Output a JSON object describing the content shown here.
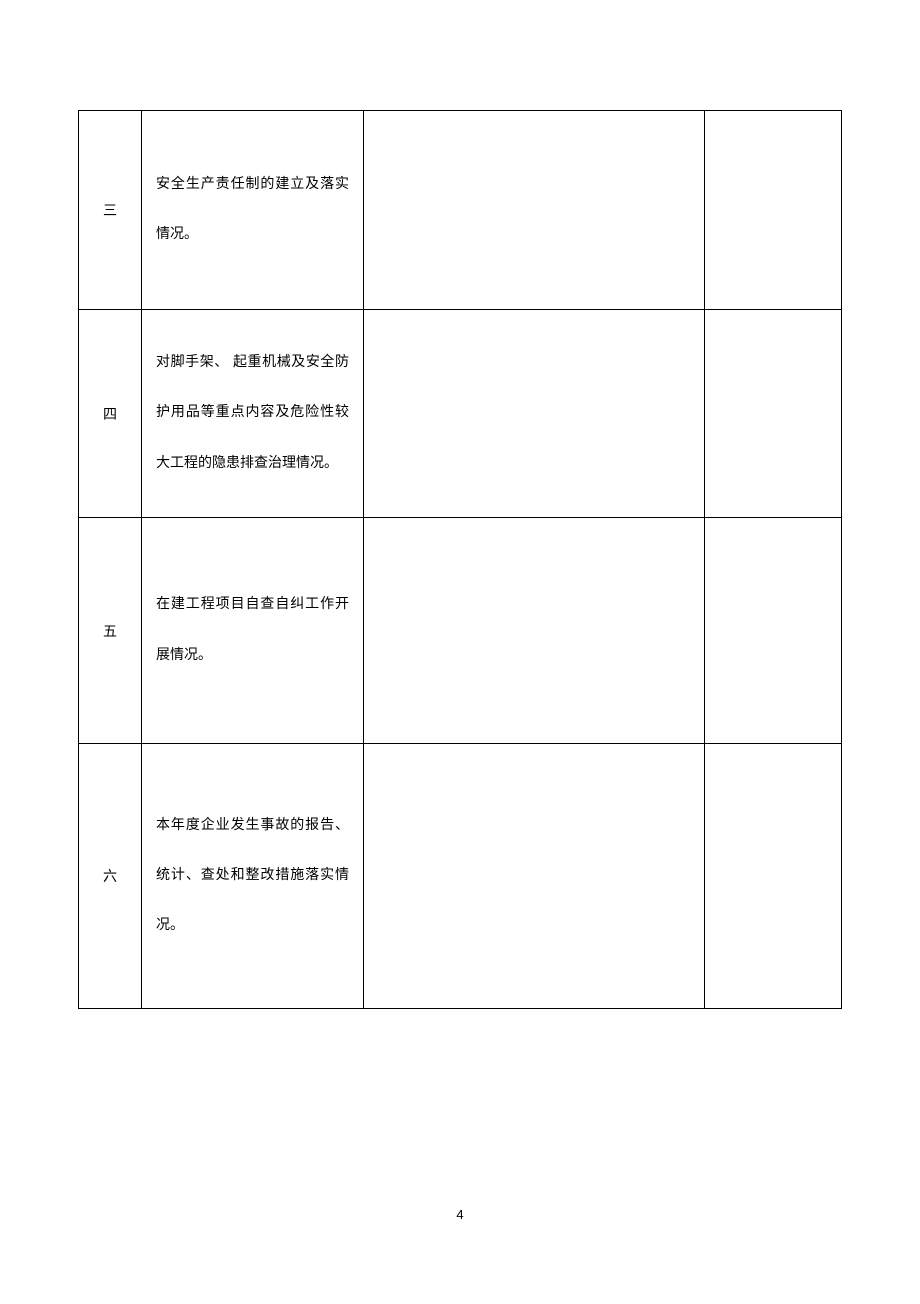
{
  "rows": [
    {
      "num": "三",
      "desc": "安全生产责任制的建立及落实情况。"
    },
    {
      "num": "四",
      "desc": "对脚手架、 起重机械及安全防护用品等重点内容及危险性较大工程的隐患排查治理情况。"
    },
    {
      "num": "五",
      "desc": "在建工程项目自查自纠工作开展情况。"
    },
    {
      "num": "六",
      "desc": "本年度企业发生事故的报告、统计、查处和整改措施落实情况。"
    }
  ],
  "pageNumber": "4"
}
